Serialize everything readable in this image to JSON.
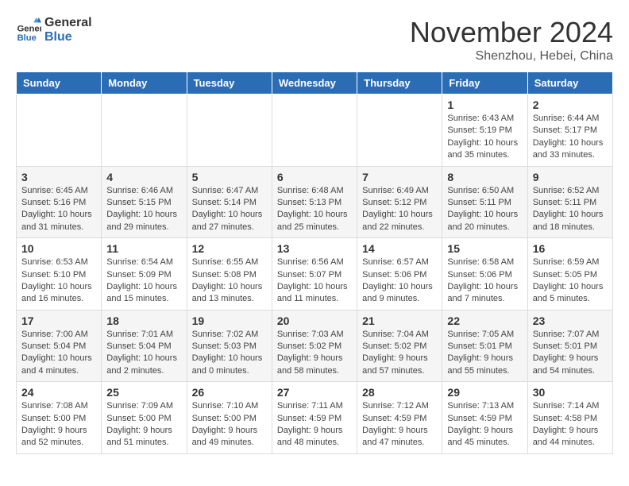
{
  "header": {
    "logo_line1": "General",
    "logo_line2": "Blue",
    "month": "November 2024",
    "location": "Shenzhou, Hebei, China"
  },
  "weekdays": [
    "Sunday",
    "Monday",
    "Tuesday",
    "Wednesday",
    "Thursday",
    "Friday",
    "Saturday"
  ],
  "weeks": [
    [
      {
        "day": "",
        "info": ""
      },
      {
        "day": "",
        "info": ""
      },
      {
        "day": "",
        "info": ""
      },
      {
        "day": "",
        "info": ""
      },
      {
        "day": "",
        "info": ""
      },
      {
        "day": "1",
        "info": "Sunrise: 6:43 AM\nSunset: 5:19 PM\nDaylight: 10 hours and 35 minutes."
      },
      {
        "day": "2",
        "info": "Sunrise: 6:44 AM\nSunset: 5:17 PM\nDaylight: 10 hours and 33 minutes."
      }
    ],
    [
      {
        "day": "3",
        "info": "Sunrise: 6:45 AM\nSunset: 5:16 PM\nDaylight: 10 hours and 31 minutes."
      },
      {
        "day": "4",
        "info": "Sunrise: 6:46 AM\nSunset: 5:15 PM\nDaylight: 10 hours and 29 minutes."
      },
      {
        "day": "5",
        "info": "Sunrise: 6:47 AM\nSunset: 5:14 PM\nDaylight: 10 hours and 27 minutes."
      },
      {
        "day": "6",
        "info": "Sunrise: 6:48 AM\nSunset: 5:13 PM\nDaylight: 10 hours and 25 minutes."
      },
      {
        "day": "7",
        "info": "Sunrise: 6:49 AM\nSunset: 5:12 PM\nDaylight: 10 hours and 22 minutes."
      },
      {
        "day": "8",
        "info": "Sunrise: 6:50 AM\nSunset: 5:11 PM\nDaylight: 10 hours and 20 minutes."
      },
      {
        "day": "9",
        "info": "Sunrise: 6:52 AM\nSunset: 5:11 PM\nDaylight: 10 hours and 18 minutes."
      }
    ],
    [
      {
        "day": "10",
        "info": "Sunrise: 6:53 AM\nSunset: 5:10 PM\nDaylight: 10 hours and 16 minutes."
      },
      {
        "day": "11",
        "info": "Sunrise: 6:54 AM\nSunset: 5:09 PM\nDaylight: 10 hours and 15 minutes."
      },
      {
        "day": "12",
        "info": "Sunrise: 6:55 AM\nSunset: 5:08 PM\nDaylight: 10 hours and 13 minutes."
      },
      {
        "day": "13",
        "info": "Sunrise: 6:56 AM\nSunset: 5:07 PM\nDaylight: 10 hours and 11 minutes."
      },
      {
        "day": "14",
        "info": "Sunrise: 6:57 AM\nSunset: 5:06 PM\nDaylight: 10 hours and 9 minutes."
      },
      {
        "day": "15",
        "info": "Sunrise: 6:58 AM\nSunset: 5:06 PM\nDaylight: 10 hours and 7 minutes."
      },
      {
        "day": "16",
        "info": "Sunrise: 6:59 AM\nSunset: 5:05 PM\nDaylight: 10 hours and 5 minutes."
      }
    ],
    [
      {
        "day": "17",
        "info": "Sunrise: 7:00 AM\nSunset: 5:04 PM\nDaylight: 10 hours and 4 minutes."
      },
      {
        "day": "18",
        "info": "Sunrise: 7:01 AM\nSunset: 5:04 PM\nDaylight: 10 hours and 2 minutes."
      },
      {
        "day": "19",
        "info": "Sunrise: 7:02 AM\nSunset: 5:03 PM\nDaylight: 10 hours and 0 minutes."
      },
      {
        "day": "20",
        "info": "Sunrise: 7:03 AM\nSunset: 5:02 PM\nDaylight: 9 hours and 58 minutes."
      },
      {
        "day": "21",
        "info": "Sunrise: 7:04 AM\nSunset: 5:02 PM\nDaylight: 9 hours and 57 minutes."
      },
      {
        "day": "22",
        "info": "Sunrise: 7:05 AM\nSunset: 5:01 PM\nDaylight: 9 hours and 55 minutes."
      },
      {
        "day": "23",
        "info": "Sunrise: 7:07 AM\nSunset: 5:01 PM\nDaylight: 9 hours and 54 minutes."
      }
    ],
    [
      {
        "day": "24",
        "info": "Sunrise: 7:08 AM\nSunset: 5:00 PM\nDaylight: 9 hours and 52 minutes."
      },
      {
        "day": "25",
        "info": "Sunrise: 7:09 AM\nSunset: 5:00 PM\nDaylight: 9 hours and 51 minutes."
      },
      {
        "day": "26",
        "info": "Sunrise: 7:10 AM\nSunset: 5:00 PM\nDaylight: 9 hours and 49 minutes."
      },
      {
        "day": "27",
        "info": "Sunrise: 7:11 AM\nSunset: 4:59 PM\nDaylight: 9 hours and 48 minutes."
      },
      {
        "day": "28",
        "info": "Sunrise: 7:12 AM\nSunset: 4:59 PM\nDaylight: 9 hours and 47 minutes."
      },
      {
        "day": "29",
        "info": "Sunrise: 7:13 AM\nSunset: 4:59 PM\nDaylight: 9 hours and 45 minutes."
      },
      {
        "day": "30",
        "info": "Sunrise: 7:14 AM\nSunset: 4:58 PM\nDaylight: 9 hours and 44 minutes."
      }
    ]
  ]
}
